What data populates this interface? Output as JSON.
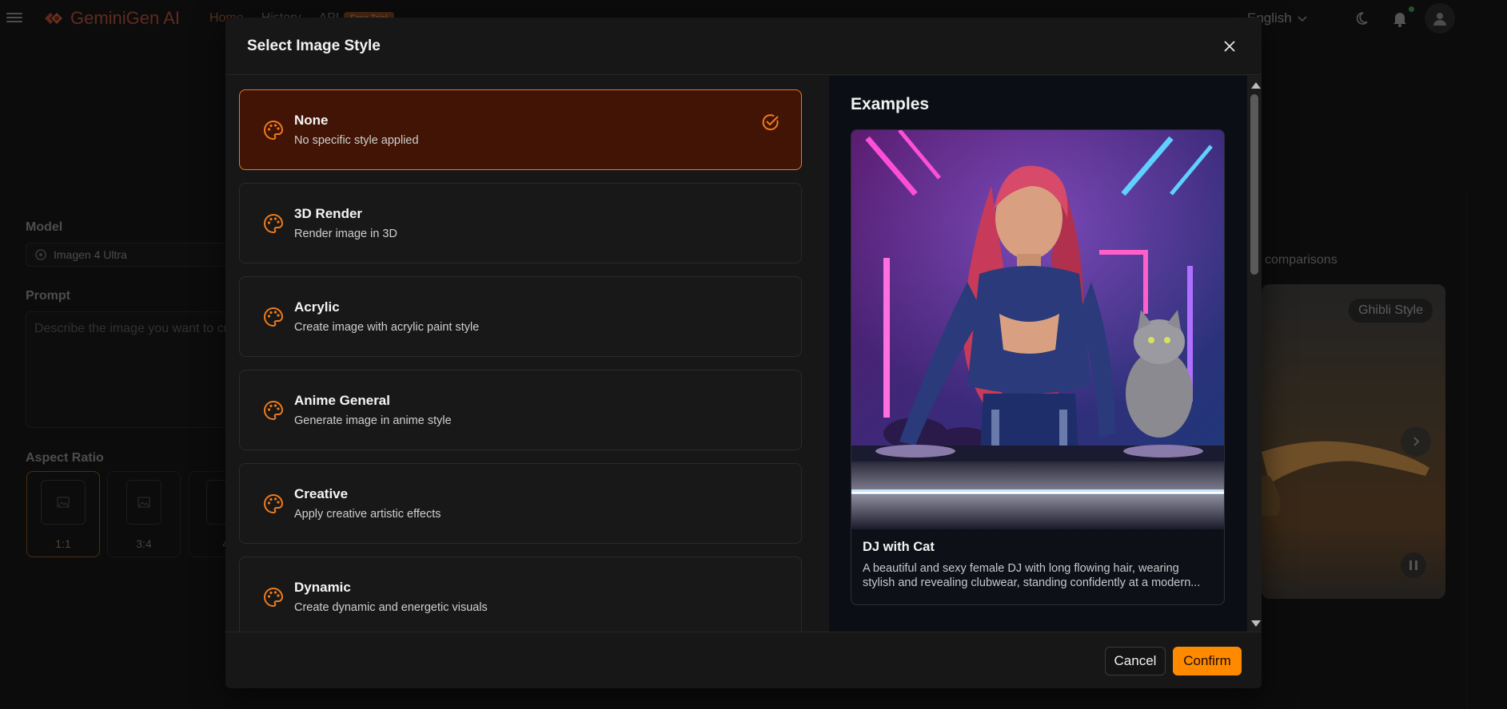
{
  "app": {
    "brand": "GeminiGen AI",
    "nav": {
      "home": "Home",
      "history": "History",
      "api": "API",
      "api_badge": "Free Trial"
    },
    "language": "English",
    "left": {
      "model_label": "Model",
      "model_value": "Imagen 4 Ultra",
      "prompt_label": "Prompt",
      "prompt_placeholder": "Describe the image you want to create",
      "aspect_label": "Aspect Ratio",
      "ratios": [
        "1:1",
        "3:4",
        "4"
      ]
    },
    "right": {
      "comparisons_text": "comparisons",
      "preview_badge": "Ghibli Style"
    }
  },
  "modal": {
    "title": "Select Image Style",
    "styles": [
      {
        "name": "None",
        "desc": "No specific style applied",
        "selected": true
      },
      {
        "name": "3D Render",
        "desc": "Render image in 3D",
        "selected": false
      },
      {
        "name": "Acrylic",
        "desc": "Create image with acrylic paint style",
        "selected": false
      },
      {
        "name": "Anime General",
        "desc": "Generate image in anime style",
        "selected": false
      },
      {
        "name": "Creative",
        "desc": "Apply creative artistic effects",
        "selected": false
      },
      {
        "name": "Dynamic",
        "desc": "Create dynamic and energetic visuals",
        "selected": false
      }
    ],
    "examples": {
      "title": "Examples",
      "item": {
        "name": "DJ with Cat",
        "desc": "A beautiful and sexy female DJ with long flowing hair, wearing stylish and revealing clubwear, standing confidently at a modern..."
      }
    },
    "buttons": {
      "cancel": "Cancel",
      "confirm": "Confirm"
    }
  },
  "colors": {
    "accent": "#ff8a00",
    "selected_bg": "#421405",
    "selected_border": "#e57a26",
    "icon_orange": "#f07b1c"
  },
  "icons": {
    "menu": "menu-icon",
    "style": "palette-icon",
    "selected": "check-circle-icon",
    "close": "close-icon",
    "theme": "moon-icon",
    "notifications": "bell-icon",
    "user": "user-icon"
  }
}
